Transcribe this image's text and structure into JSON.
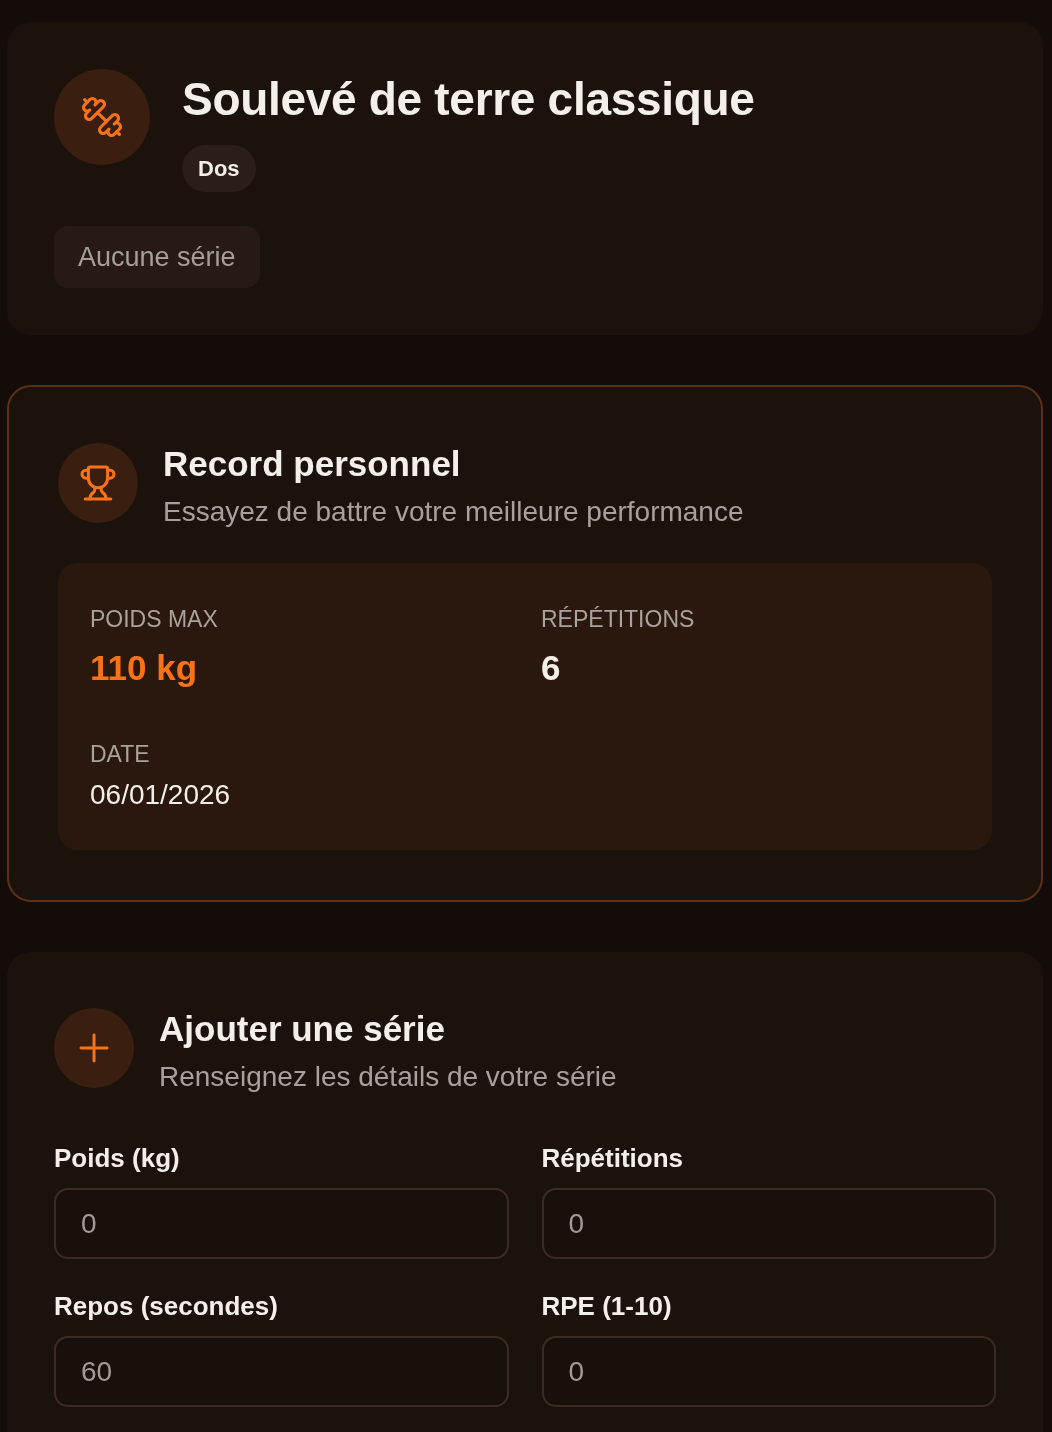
{
  "exercise": {
    "title": "Soulevé de terre classique",
    "category": "Dos",
    "sets_summary": "Aucune série"
  },
  "personal_record": {
    "title": "Record personnel",
    "subtitle": "Essayez de battre votre meilleure performance",
    "stats": [
      {
        "kind": "highlight",
        "label": "POIDS MAX",
        "value": "110 kg"
      },
      {
        "kind": "metric",
        "label": "RÉPÉTITIONS",
        "value": "6"
      },
      {
        "kind": "date",
        "label": "DATE",
        "value": "06/01/2026"
      }
    ]
  },
  "add_set": {
    "title": "Ajouter une série",
    "subtitle": "Renseignez les détails de votre série",
    "fields": [
      {
        "label": "Poids (kg)",
        "value": "0"
      },
      {
        "label": "Répétitions",
        "value": "0"
      },
      {
        "label": "Repos (secondes)",
        "value": "60"
      },
      {
        "label": "RPE (1-10)",
        "value": "0"
      }
    ]
  }
}
